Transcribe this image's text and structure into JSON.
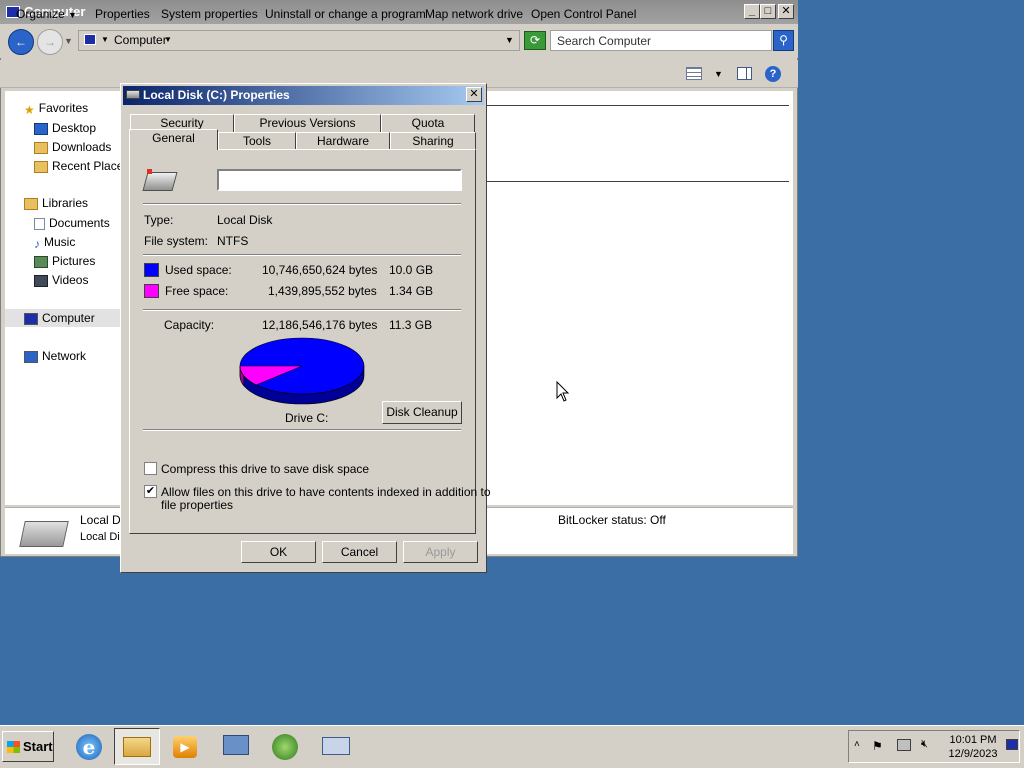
{
  "explorer": {
    "title": "Computer",
    "address": "Computer",
    "search_placeholder": "Search Computer",
    "commands": [
      "Organize",
      "Properties",
      "System properties",
      "Uninstall or change a program",
      "Map network drive",
      "Open Control Panel"
    ],
    "nav": {
      "favorites": "Favorites",
      "desktop": "Desktop",
      "downloads": "Downloads",
      "recent": "Recent Places",
      "libraries": "Libraries",
      "documents": "Documents",
      "music": "Music",
      "pictures": "Pictures",
      "videos": "Videos",
      "computer": "Computer",
      "network": "Network"
    },
    "details": {
      "name": "Local D",
      "sub": "Local Dis",
      "bitlocker": "BitLocker status: Off"
    }
  },
  "dialog": {
    "title": "Local Disk (C:) Properties",
    "close_glyph": "✕",
    "tabs_back": [
      "Security",
      "Previous Versions",
      "Quota"
    ],
    "tabs_front": [
      "General",
      "Tools",
      "Hardware",
      "Sharing"
    ],
    "active_tab": "General",
    "drive_label_value": "",
    "type_label": "Type:",
    "type_value": "Local Disk",
    "fs_label": "File system:",
    "fs_value": "NTFS",
    "used_label": "Used space:",
    "used_bytes": "10,746,650,624 bytes",
    "used_gb": "10.0 GB",
    "free_label": "Free space:",
    "free_bytes": "1,439,895,552 bytes",
    "free_gb": "1.34 GB",
    "capacity_label": "Capacity:",
    "capacity_bytes": "12,186,546,176 bytes",
    "capacity_gb": "11.3 GB",
    "drive_caption": "Drive C:",
    "cleanup_label": "Disk Cleanup",
    "compress_label": "Compress this drive to save disk space",
    "compress_checked": false,
    "index_label_1": "Allow files on this drive to have contents indexed in addition to",
    "index_label_2": "file properties",
    "index_checked": true,
    "index_glyph": "✔",
    "ok_label": "OK",
    "cancel_label": "Cancel",
    "apply_label": "Apply",
    "colors": {
      "used": "#0000ff",
      "free": "#ff00ff"
    }
  },
  "usage_fraction": {
    "used": 0.8818,
    "free": 0.1182
  },
  "taskbar": {
    "start_label": "Start",
    "time": "10:01 PM",
    "date": "12/9/2023",
    "icons": [
      "ie-icon",
      "explorer-icon",
      "media-player-icon",
      "server-manager-icon",
      "windows-icon",
      "keyboard-icon"
    ]
  }
}
